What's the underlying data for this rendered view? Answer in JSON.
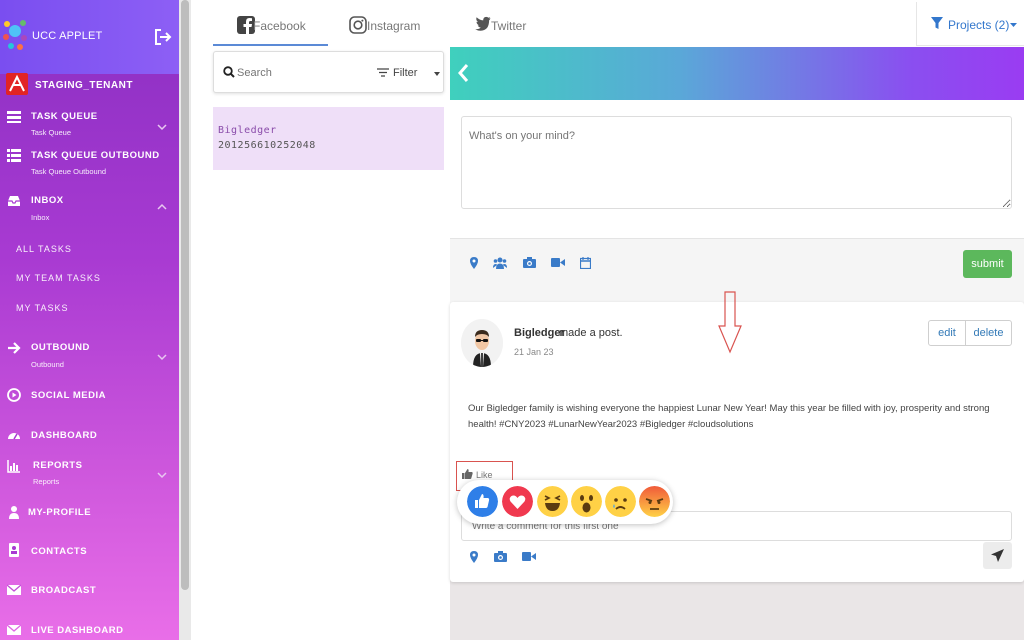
{
  "app": {
    "title": "UCC APPLET"
  },
  "tenant": {
    "name": "STAGING_TENANT"
  },
  "sidebar": {
    "items": [
      {
        "label": "TASK QUEUE",
        "sub": "Task Queue"
      },
      {
        "label": "TASK QUEUE OUTBOUND",
        "sub": "Task Queue Outbound"
      },
      {
        "label": "INBOX",
        "sub": "Inbox"
      },
      {
        "label": "OUTBOUND",
        "sub": "Outbound"
      },
      {
        "label": "SOCIAL MEDIA"
      },
      {
        "label": "DASHBOARD"
      },
      {
        "label": "REPORTS",
        "sub": "Reports"
      },
      {
        "label": "MY-PROFILE"
      },
      {
        "label": "CONTACTS"
      },
      {
        "label": "BROADCAST"
      },
      {
        "label": "LIVE DASHBOARD"
      }
    ],
    "inbox_links": [
      "ALL TASKS",
      "MY TEAM TASKS",
      "MY TASKS"
    ]
  },
  "tabs": {
    "facebook": "Facebook",
    "instagram": "Instagram",
    "twitter": "Twitter"
  },
  "projects": {
    "label": "Projects (2)"
  },
  "search": {
    "placeholder": "Search",
    "filter_label": "Filter"
  },
  "account": {
    "name": "Bigledger",
    "id": "201256610252048"
  },
  "composer": {
    "placeholder": "What's on your mind?",
    "submit_label": "submit"
  },
  "post": {
    "author": "Bigledger",
    "action": "made a post.",
    "date": "21 Jan 23",
    "edit_label": "edit",
    "delete_label": "delete",
    "text": "Our Bigledger family is wishing everyone the happiest Lunar New Year! May this year be filled with joy, prosperity and strong health! #CNY2023 #LunarNewYear2023 #Bigledger #cloudsolutions",
    "like_label": "Like",
    "comment_placeholder": "Write a comment for this first one"
  },
  "reactions": [
    "like",
    "love",
    "haha",
    "wow",
    "sad",
    "angry"
  ],
  "colors": {
    "accent": "#8a2fc2",
    "link": "#337ab7",
    "submit": "#5cb85c",
    "annotation": "#d9534f"
  }
}
